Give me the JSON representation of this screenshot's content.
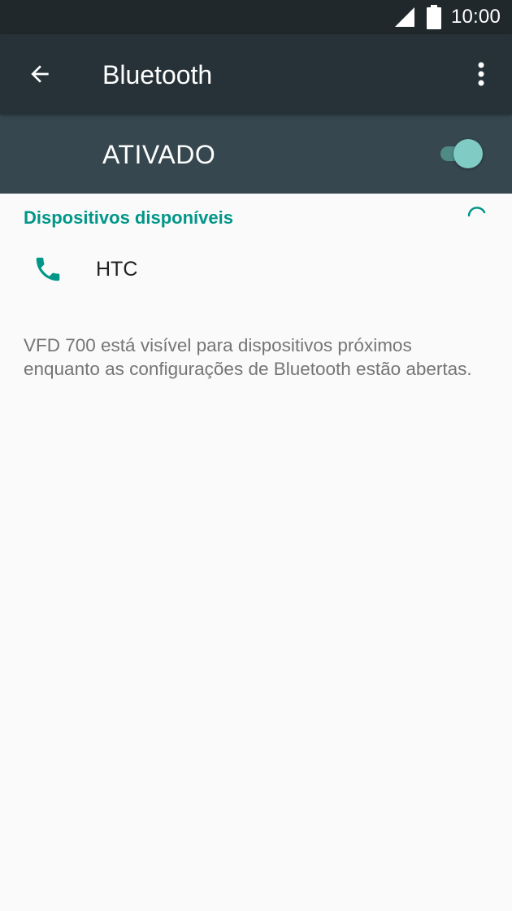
{
  "status_bar": {
    "time": "10:00",
    "icons": [
      "signal-icon",
      "battery-icon"
    ]
  },
  "app_bar": {
    "title": "Bluetooth",
    "back_icon": "arrow-back-icon",
    "menu_icon": "more-vert-icon"
  },
  "master_switch": {
    "label": "ATIVADO",
    "state": "on"
  },
  "available_devices": {
    "header": "Dispositivos disponíveis",
    "scanning": true,
    "devices": [
      {
        "name": "HTC",
        "icon": "phone-icon"
      }
    ]
  },
  "visibility_note": "VFD 700 está visível para dispositivos próximos enquanto as configurações de Bluetooth estão abertas.",
  "colors": {
    "status_bar": "#20282c",
    "app_bar": "#273238",
    "switch_bar": "#37474f",
    "accent": "#009688",
    "toggle_thumb": "#80cbc4",
    "background": "#fafafa"
  }
}
